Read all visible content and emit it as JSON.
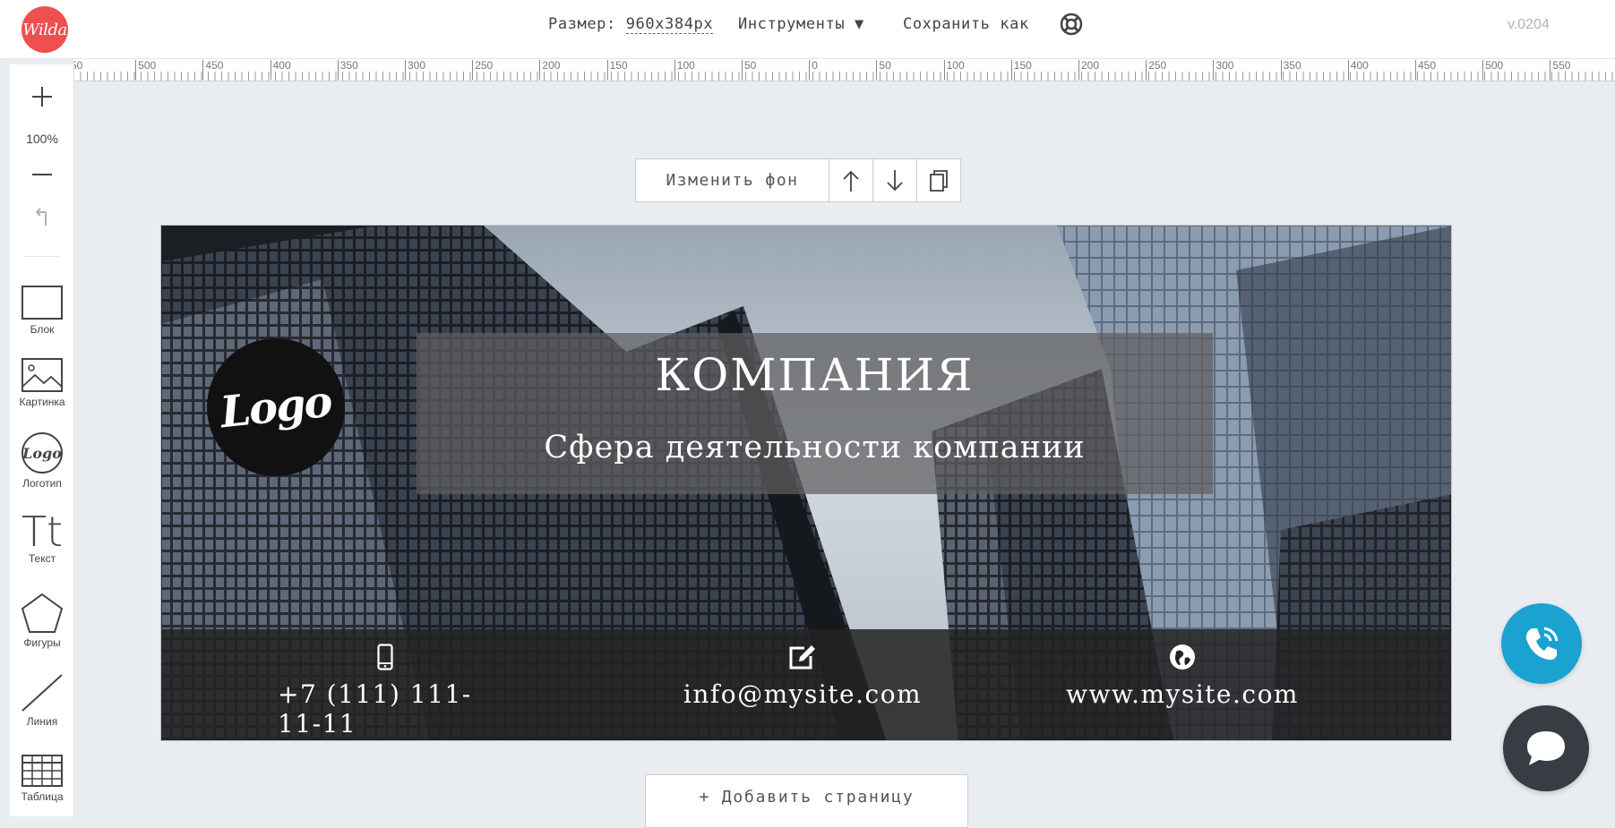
{
  "app": {
    "logo_text": "Wilda",
    "version": "v.0204"
  },
  "topbar": {
    "size_label": "Размер:",
    "size_value": "960x384px",
    "tools_label": "Инструменты ▼",
    "save_as_label": "Сохранить как",
    "help_icon": "lifebuoy-icon"
  },
  "ruler": {
    "ticks": [
      "50",
      "500",
      "450",
      "400",
      "350",
      "300",
      "250",
      "200",
      "150",
      "100",
      "50",
      "0",
      "50",
      "100",
      "150",
      "200",
      "250",
      "300",
      "350",
      "400",
      "450",
      "500",
      "550"
    ]
  },
  "left_toolbar": {
    "zoom_in_icon": "plus-icon",
    "zoom_value": "100%",
    "zoom_out_icon": "minus-icon",
    "undo_icon": "undo-icon",
    "tools": [
      {
        "label": "Блок",
        "icon": "rectangle-icon"
      },
      {
        "label": "Картинка",
        "icon": "image-icon"
      },
      {
        "label": "Логотип",
        "icon": "logo-icon",
        "icon_text": "Logo"
      },
      {
        "label": "Текст",
        "icon": "text-icon",
        "icon_text": "Tt"
      },
      {
        "label": "Фигуры",
        "icon": "pentagon-icon"
      },
      {
        "label": "Линия",
        "icon": "line-icon"
      },
      {
        "label": "Таблица",
        "icon": "table-icon"
      }
    ]
  },
  "block_toolbar": {
    "change_bg_label": "Изменить фон",
    "icons": [
      "arrow-up-icon",
      "arrow-down-icon",
      "copy-icon"
    ]
  },
  "banner": {
    "logo_text": "Logo",
    "title": "КОМПАНИЯ",
    "subtitle": "Сфера деятельности компании",
    "contacts": [
      {
        "icon": "mobile-phone-icon",
        "text": "+7 (111) 111-11-11"
      },
      {
        "icon": "edit-icon",
        "text": "info@mysite.com"
      },
      {
        "icon": "globe-icon",
        "text": "www.mysite.com"
      }
    ]
  },
  "add_page_label": "+ Добавить страницу",
  "widgets": {
    "call_icon": "phone-call-icon",
    "chat_icon": "chat-bubble-icon"
  },
  "colors": {
    "brand": "#ef4f4f",
    "call": "#1aa2d1",
    "chat": "#373d43",
    "workspace": "#e9edf1"
  }
}
